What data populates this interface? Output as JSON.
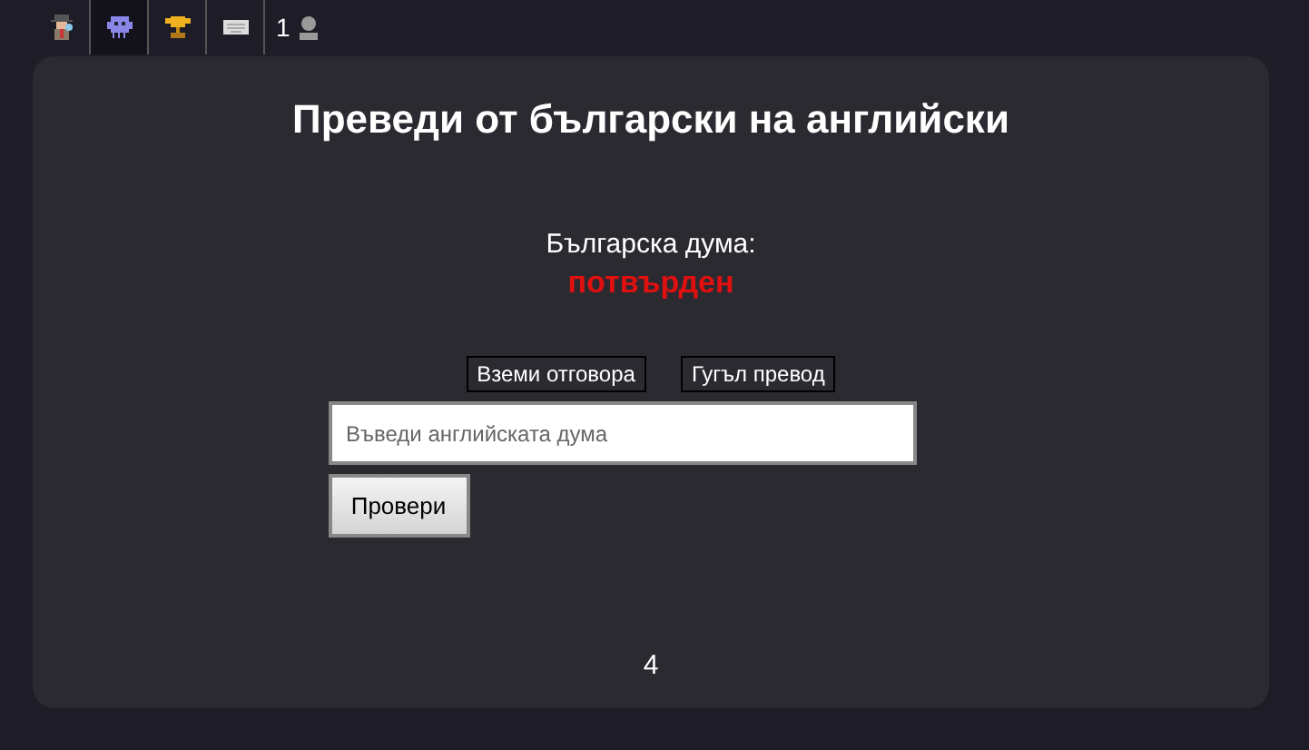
{
  "toolbar": {
    "tabs": [
      {
        "kind": "detective",
        "selected": false
      },
      {
        "kind": "alien",
        "selected": true
      },
      {
        "kind": "trophy",
        "selected": false
      },
      {
        "kind": "keyboard",
        "selected": false
      }
    ],
    "count": "1"
  },
  "card": {
    "title": "Преведи от български на английски",
    "prompt_label": "Българска дума:",
    "word": "потвърден",
    "buttons": [
      "Вземи отговора",
      "Гугъл превод"
    ],
    "answer": {
      "placeholder": "Въведи английската дума"
    },
    "submit": "Провери",
    "footer": "4"
  }
}
